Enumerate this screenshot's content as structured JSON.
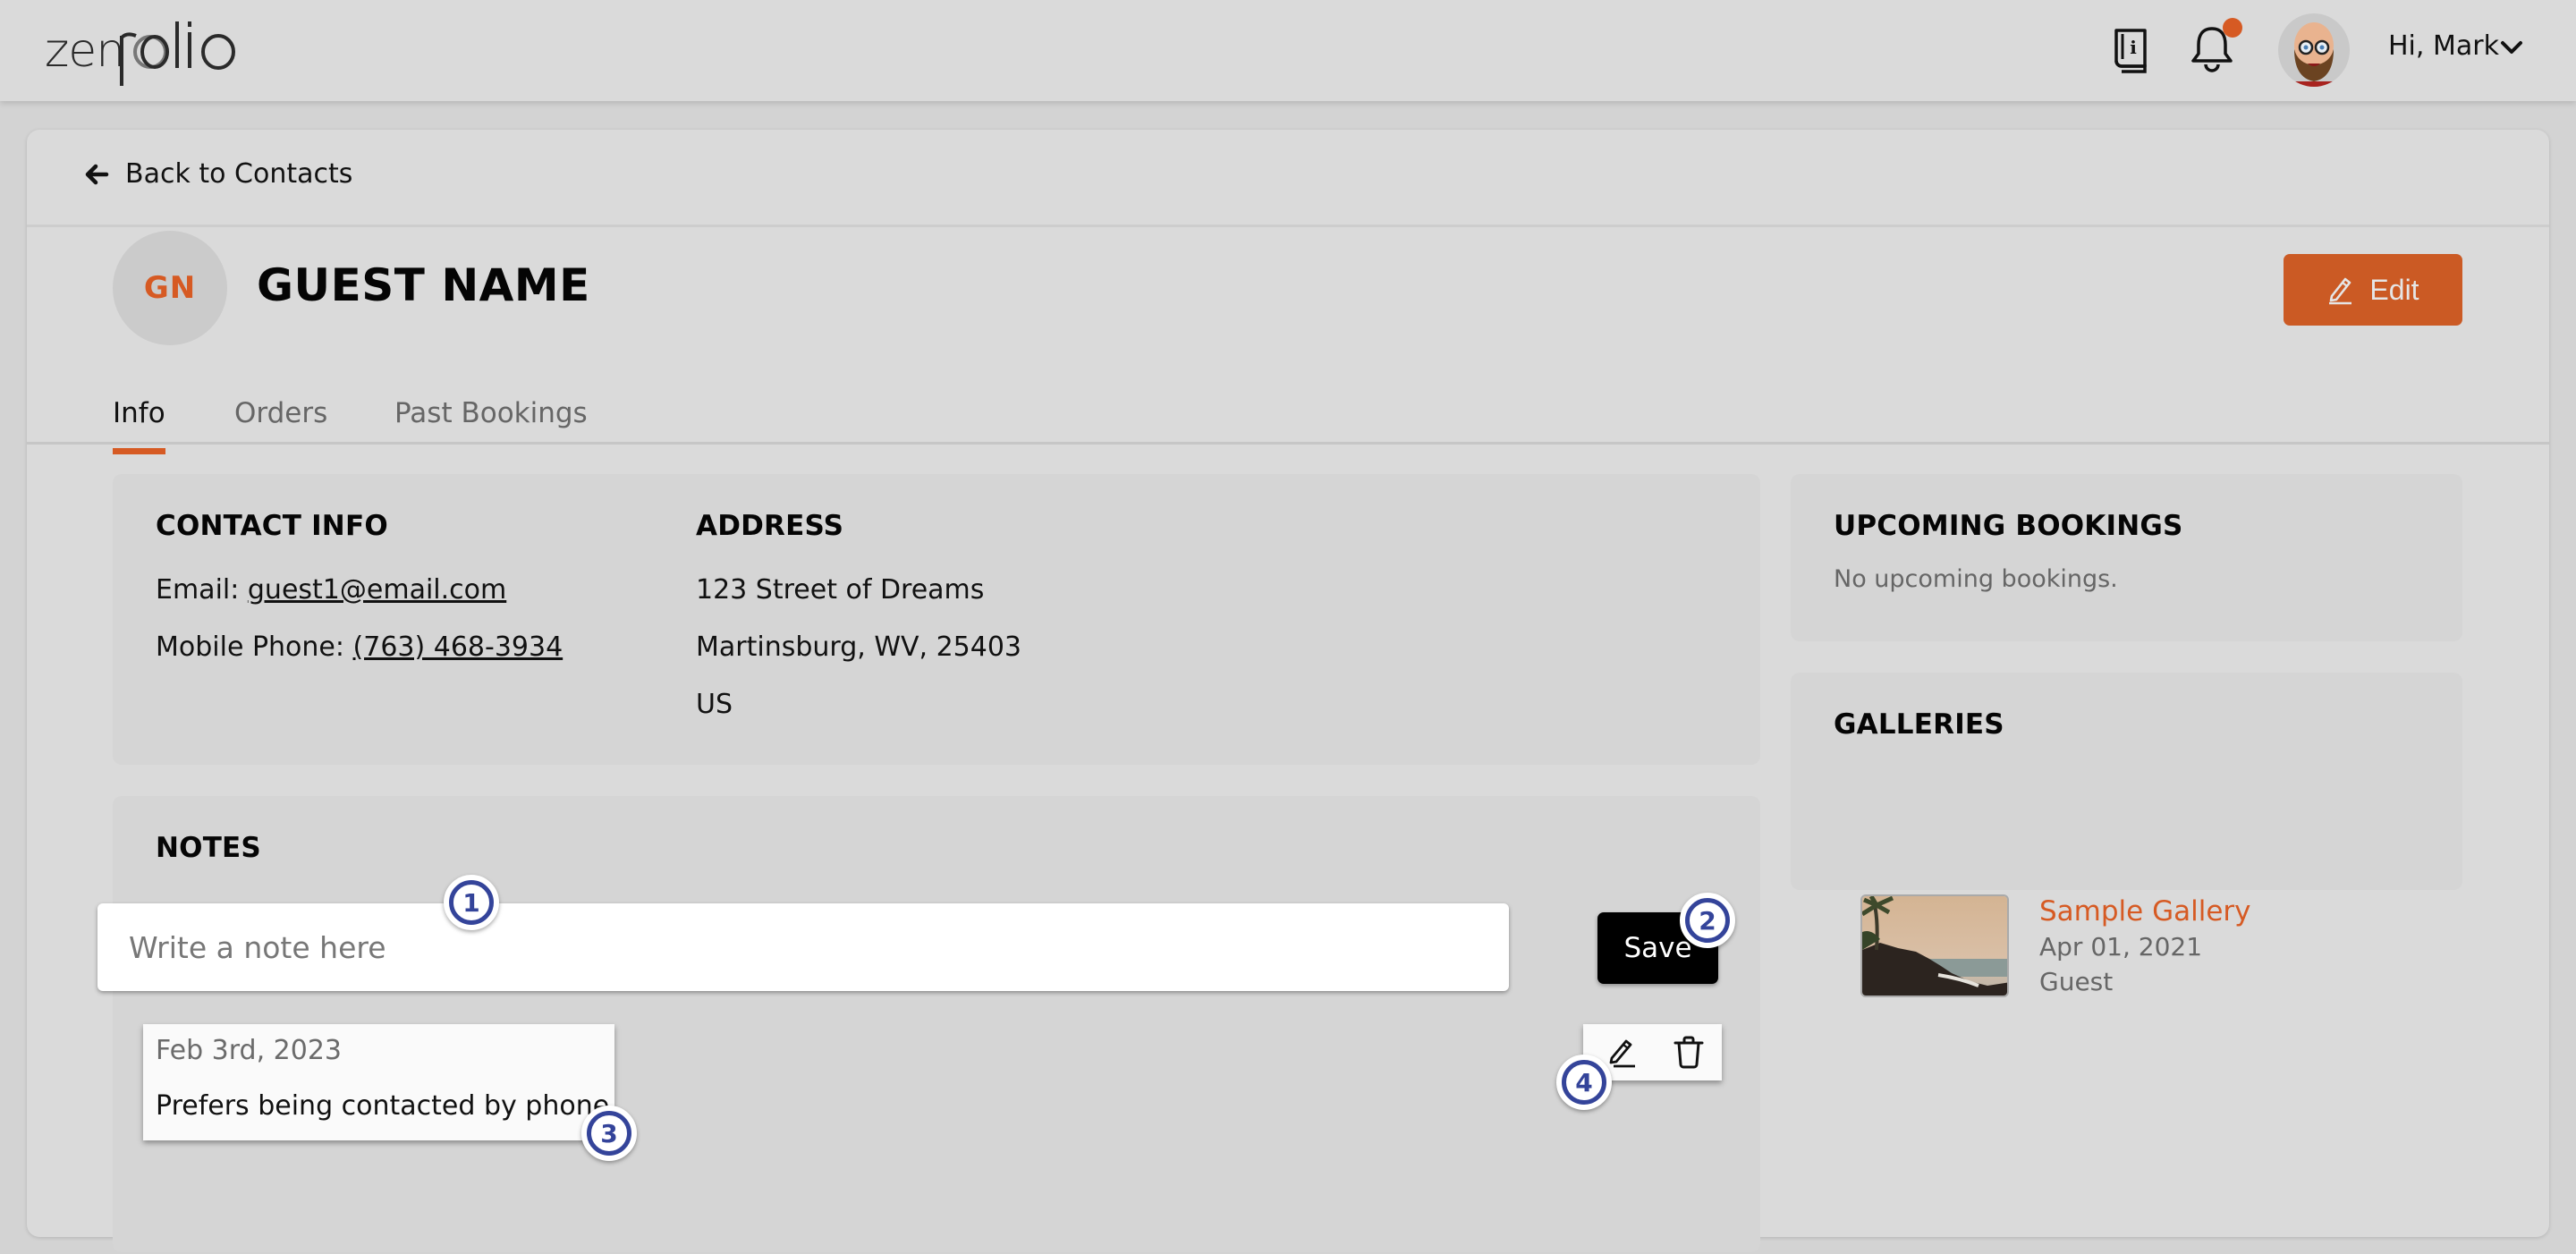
{
  "header": {
    "logo_text": "zenfolio",
    "greeting": "Hi, Mark",
    "icons": [
      "guide-book-icon",
      "notification-bell-icon",
      "user-avatar",
      "chevron-down-icon"
    ],
    "notification_dot_color": "#d65a23"
  },
  "nav": {
    "back_label": "Back to Contacts"
  },
  "contact": {
    "initials": "GN",
    "name": "GUEST NAME",
    "edit_label": "Edit"
  },
  "tabs": [
    {
      "label": "Info",
      "active": true
    },
    {
      "label": "Orders",
      "active": false
    },
    {
      "label": "Past Bookings",
      "active": false
    }
  ],
  "contact_info": {
    "title": "CONTACT INFO",
    "email_label": "Email: ",
    "email": "guest1@email.com",
    "phone_label": "Mobile Phone: ",
    "phone": "(763) 468-3934"
  },
  "address": {
    "title": "ADDRESS",
    "line1": "123 Street of Dreams",
    "line2": "Martinsburg, WV, 25403",
    "country": "US"
  },
  "notes": {
    "title": "NOTES",
    "input_placeholder": "Write a note here",
    "input_value": "",
    "save_label": "Save",
    "items": [
      {
        "date": "Feb 3rd, 2023",
        "text": "Prefers being contacted by phone"
      }
    ]
  },
  "upcoming_bookings": {
    "title": "UPCOMING BOOKINGS",
    "empty_text": "No upcoming bookings."
  },
  "galleries": {
    "title": "GALLERIES",
    "items": [
      {
        "name": "Sample Gallery",
        "date": "Apr 01, 2021",
        "role": "Guest"
      }
    ]
  },
  "annotations": [
    "1",
    "2",
    "3",
    "4"
  ],
  "colors": {
    "accent": "#d65a23",
    "edit_button": "#cb5a24",
    "save_button": "#000000",
    "badge": "#34449a",
    "background": "#dadada"
  }
}
